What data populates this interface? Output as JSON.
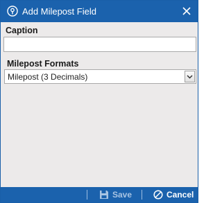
{
  "window": {
    "title": "Add Milepost Field",
    "title_icon": "milepost-icon",
    "close_icon": "close-icon"
  },
  "form": {
    "caption_label": "Caption",
    "caption_value": "",
    "formats_label": "Milepost Formats",
    "formats_selected": "Milepost (3 Decimals)"
  },
  "footer": {
    "save_label": "Save",
    "save_enabled": false,
    "cancel_label": "Cancel"
  },
  "colors": {
    "accent": "#1b62ad",
    "body_bg": "#eceaea",
    "disabled_text": "#a8c4e3"
  }
}
